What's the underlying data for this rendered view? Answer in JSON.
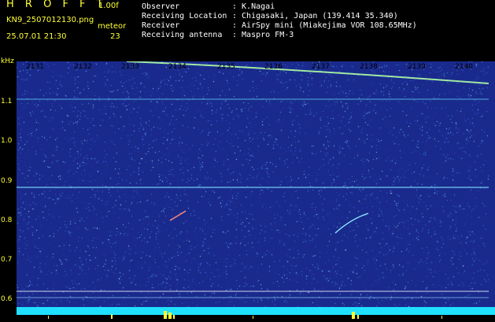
{
  "header": {
    "app_title": "H R O F F T",
    "version": "1.00f",
    "filename": "KN9_2507012130.png",
    "datetime": "25.07.01 21:30",
    "meteor_label": "meteor",
    "meteor_count": "23",
    "info": [
      {
        "label": "Observer",
        "value": ": K.Nagai"
      },
      {
        "label": "Receiving Location",
        "value": ": Chigasaki, Japan (139.414 35.340)"
      },
      {
        "label": "Receiver",
        "value": ": AirSpy mini (Miakejima VOR 108.65MHz)"
      },
      {
        "label": "Receiving antenna",
        "value": ": Maspro FM-3"
      }
    ]
  },
  "axis": {
    "y_unit": "kHz",
    "y_ticks": [
      "1.1",
      "1.0",
      "0.9",
      "0.8",
      "0.7",
      "0.6"
    ],
    "x_ticks": [
      "2131",
      "2132",
      "2133",
      "2134",
      "2135",
      "2136",
      "2137",
      "2138",
      "2139",
      "2140"
    ]
  },
  "colors": {
    "background": "#1a2a8c",
    "label": "#ffff33",
    "bottom_bar": "#20e0ff"
  }
}
